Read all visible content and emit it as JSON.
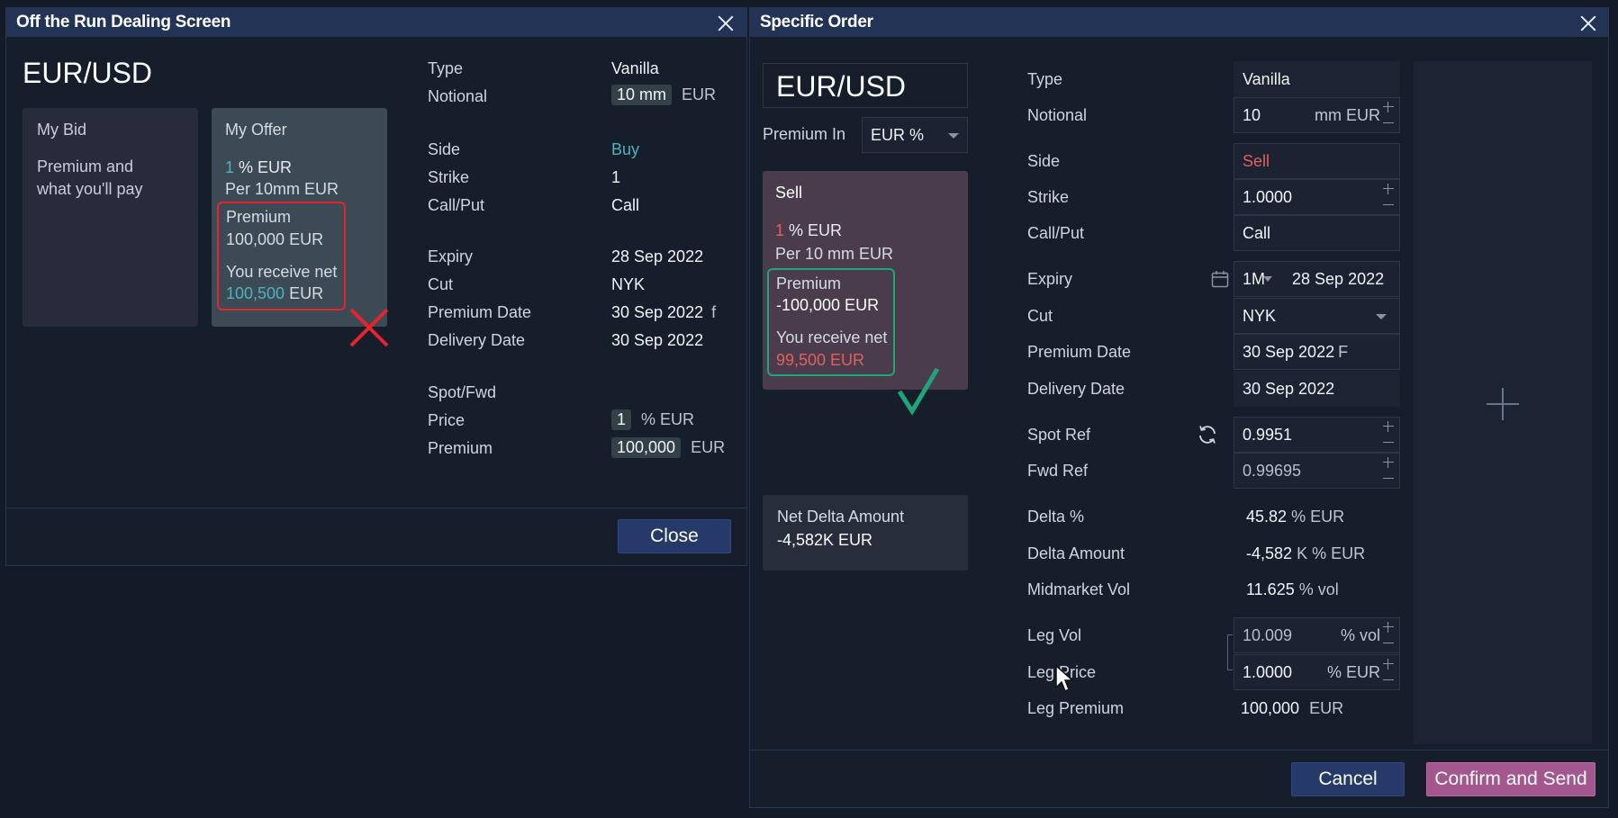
{
  "left_window": {
    "title": "Off the Run Dealing Screen",
    "pair": "EUR/USD",
    "bid": {
      "heading": "My Bid",
      "line1": "Premium and",
      "line2": "what you'll pay"
    },
    "offer": {
      "heading": "My Offer",
      "pct_value": "1",
      "pct_unit": "% EUR",
      "per": "Per 10mm EUR",
      "premium_label": "Premium",
      "premium_value": "100,000 EUR",
      "receive_label": "You receive net",
      "receive_value": "100,500",
      "receive_unit": "EUR"
    },
    "details": {
      "type_label": "Type",
      "type_value": "Vanilla",
      "notional_label": "Notional",
      "notional_value": "10 mm",
      "notional_unit": "EUR",
      "side_label": "Side",
      "side_value": "Buy",
      "strike_label": "Strike",
      "strike_value": "1",
      "callput_label": "Call/Put",
      "callput_value": "Call",
      "expiry_label": "Expiry",
      "expiry_value": "28 Sep 2022",
      "cut_label": "Cut",
      "cut_value": "NYK",
      "premium_date_label": "Premium Date",
      "premium_date_value": "30 Sep 2022",
      "premium_date_flag": "f",
      "delivery_date_label": "Delivery Date",
      "delivery_date_value": "30 Sep 2022",
      "spotfwd_label": "Spot/Fwd",
      "price_label": "Price",
      "price_value": "1",
      "price_unit": "% EUR",
      "premium_label": "Premium",
      "premium_value": "100,000",
      "premium_unit": "EUR"
    },
    "close_label": "Close"
  },
  "right_window": {
    "title": "Specific Order",
    "pair": "EUR/USD",
    "premium_in_label": "Premium In",
    "premium_in_value": "EUR %",
    "sell_card": {
      "heading": "Sell",
      "pct_value": "1",
      "pct_unit": "% EUR",
      "per": "Per 10 mm EUR",
      "premium_label": "Premium",
      "premium_value": "-100,000 EUR",
      "receive_label": "You receive net",
      "receive_value": "99,500 EUR"
    },
    "net_delta": {
      "label": "Net Delta Amount",
      "value": "-4,582K EUR"
    },
    "form": {
      "type_label": "Type",
      "type_value": "Vanilla",
      "notional_label": "Notional",
      "notional_value": "10",
      "notional_unit": "mm EUR",
      "side_label": "Side",
      "side_value": "Sell",
      "strike_label": "Strike",
      "strike_value": "1.0000",
      "callput_label": "Call/Put",
      "callput_value": "Call",
      "expiry_label": "Expiry",
      "expiry_tenor": "1M",
      "expiry_value": "28 Sep 2022",
      "cut_label": "Cut",
      "cut_value": "NYK",
      "premium_date_label": "Premium Date",
      "premium_date_value": "30 Sep 2022",
      "premium_date_flag": "F",
      "delivery_date_label": "Delivery Date",
      "delivery_date_value": "30 Sep 2022",
      "spot_ref_label": "Spot Ref",
      "spot_ref_value": "0.9951",
      "fwd_ref_label": "Fwd Ref",
      "fwd_ref_value": "0.99695",
      "delta_pct_label": "Delta %",
      "delta_pct_value": "45.82",
      "delta_pct_unit": "% EUR",
      "delta_amount_label": "Delta Amount",
      "delta_amount_value": "-4,582",
      "delta_amount_unit": "K % EUR",
      "midmarket_vol_label": "Midmarket Vol",
      "midmarket_vol_value": "11.625",
      "midmarket_vol_unit": "% vol",
      "leg_vol_label": "Leg Vol",
      "leg_vol_value": "10.009",
      "leg_vol_unit": "% vol",
      "leg_price_label": "Leg Price",
      "leg_price_value": "1.0000",
      "leg_price_unit": "% EUR",
      "leg_premium_label": "Leg Premium",
      "leg_premium_value": "100,000",
      "leg_premium_unit": "EUR"
    },
    "cancel_label": "Cancel",
    "confirm_label": "Confirm and Send"
  },
  "colors": {
    "titlebar": "#223355",
    "buy_teal": "#4fb3bc",
    "sell_red": "#e0615b",
    "reject_red": "#e5242b",
    "accept_green": "#1ea57a",
    "confirm_purple": "#a4568f"
  },
  "icons": [
    "close-icon",
    "red-cross-mark-icon",
    "green-check-mark-icon",
    "calendar-icon",
    "refresh-icon",
    "plus-icon",
    "mouse-pointer-icon"
  ]
}
